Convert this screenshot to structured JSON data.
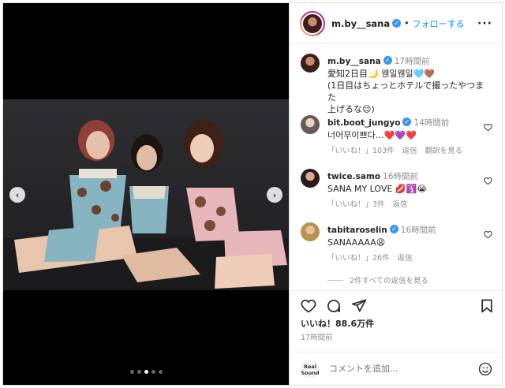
{
  "header": {
    "username": "m.by__sana",
    "follow_label": "フォローする",
    "more_label": "···"
  },
  "caption": {
    "username": "m.by__sana",
    "time": "17時間前",
    "lines": [
      "愛知2日目🌙 웬일웬일🩵🤎",
      "(1日目はちょっとホテルで撮ったやつまた",
      "上げるな😌)"
    ]
  },
  "comments": [
    {
      "username": "bit.boot_jungyo",
      "time": "14時間前",
      "text": "너어무이쁘다…❤️💜❤️",
      "likes": "「いいね！」103件",
      "reply": "返信",
      "translate": "翻訳を見る"
    },
    {
      "username": "twice.samo",
      "time": "16時間前",
      "text": "SANA MY LOVE 💋🛐😭",
      "likes": "「いいね！」3件",
      "reply": "返信",
      "translate": ""
    },
    {
      "username": "tabitaroselin",
      "time": "16時間前",
      "text": "SANAAAAA😩",
      "likes": "「いいね！」26件",
      "reply": "返信",
      "translate": ""
    }
  ],
  "view_replies": "2件すべての返信を見る",
  "post": {
    "likes": "いいね！88.6万件",
    "time": "17時間前"
  },
  "add_comment": {
    "placeholder": "コメントを追加...",
    "brand_logo_text": "Real Sound"
  },
  "carousel": {
    "slide_count": 5,
    "active_index": 2
  },
  "colors": {
    "accent": "#0095f6",
    "verified": "#3897f0",
    "muted": "#8e8e8e",
    "heart": "#ed4956"
  }
}
